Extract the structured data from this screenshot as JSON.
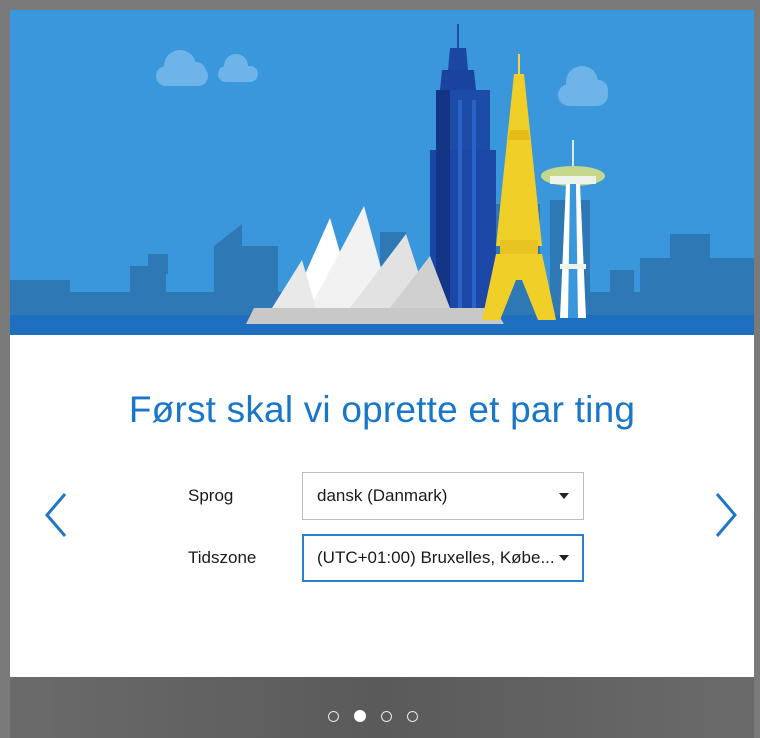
{
  "setup": {
    "title": "Først skal vi oprette et par ting",
    "fields": [
      {
        "label": "Sprog",
        "value": "dansk (Danmark)"
      },
      {
        "label": "Tidszone",
        "value": "(UTC+01:00) Bruxelles, Købe..."
      }
    ]
  },
  "navigation": {
    "prev_icon": "chevron-left-icon",
    "next_icon": "chevron-right-icon"
  },
  "pagination": {
    "total": 4,
    "current": 2
  },
  "colors": {
    "sky": "#3a97dc",
    "title": "#1976c9",
    "accent": "#2b7fcf",
    "footer": "#5f5f5f"
  }
}
